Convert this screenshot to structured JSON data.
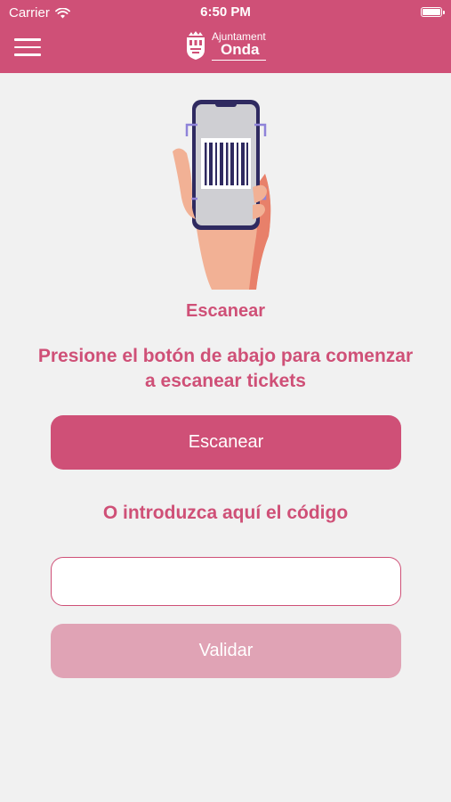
{
  "status_bar": {
    "carrier": "Carrier",
    "time": "6:50 PM"
  },
  "header": {
    "logo_line1": "Ajuntament",
    "logo_line2": "Onda"
  },
  "main": {
    "title": "Escanear",
    "instruction": "Presione el botón de abajo para comenzar a escanear tickets",
    "scan_button_label": "Escanear",
    "or_label": "O introduzca aquí el código",
    "code_input_value": "",
    "validate_button_label": "Validar"
  },
  "colors": {
    "brand": "#cf5077",
    "brand_disabled": "#e0a3b5",
    "background": "#f1f1f1"
  },
  "icons": [
    "menu-icon",
    "wifi-icon",
    "battery-icon",
    "crest-icon",
    "barcode-scan-illustration"
  ]
}
